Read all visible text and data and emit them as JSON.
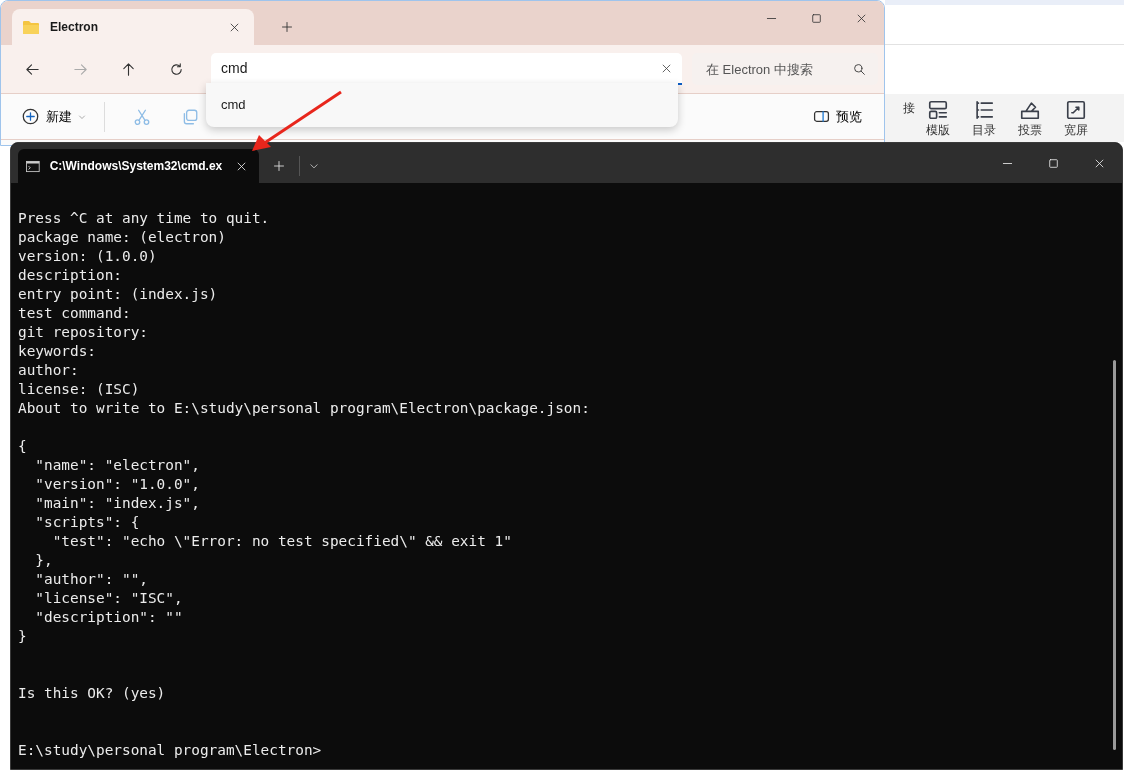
{
  "explorer": {
    "tabs": [
      {
        "title": "Electron",
        "selected": true
      }
    ],
    "address": {
      "value": "cmd",
      "focused": true
    },
    "search": {
      "placeholder": "在 Electron 中搜索"
    },
    "suggestions": [
      "cmd"
    ],
    "toolbar": {
      "new_label": "新建",
      "preview_label": "预览"
    }
  },
  "background_app": {
    "toolbar": [
      "接",
      "模版",
      "目录",
      "投票",
      "宽屏"
    ]
  },
  "terminal": {
    "tabs": [
      {
        "title": "C:\\Windows\\System32\\cmd.ex",
        "selected": true
      }
    ],
    "lines": [
      {
        "kind": "text",
        "text": "Press ^C at any time to quit."
      },
      {
        "kind": "text",
        "text": "package name: (electron)"
      },
      {
        "kind": "text",
        "text": "version: (1.0.0)"
      },
      {
        "kind": "text",
        "text": "description:"
      },
      {
        "kind": "text",
        "text": "entry point: (index.js)"
      },
      {
        "kind": "text",
        "text": "test command:"
      },
      {
        "kind": "text",
        "text": "git repository:"
      },
      {
        "kind": "text",
        "text": "keywords:"
      },
      {
        "kind": "text",
        "text": "author:"
      },
      {
        "kind": "text",
        "text": "license: (ISC)"
      },
      {
        "kind": "text",
        "text": "About to write to E:\\study\\personal program\\Electron\\package.json:"
      },
      {
        "kind": "blank"
      },
      {
        "kind": "text",
        "text": "{"
      },
      {
        "kind": "text",
        "text": "  \"name\": \"electron\","
      },
      {
        "kind": "text",
        "text": "  \"version\": \"1.0.0\","
      },
      {
        "kind": "text",
        "text": "  \"main\": \"index.js\","
      },
      {
        "kind": "text",
        "text": "  \"scripts\": {"
      },
      {
        "kind": "text",
        "text": "    \"test\": \"echo \\\"Error: no test specified\\\" && exit 1\""
      },
      {
        "kind": "text",
        "text": "  },"
      },
      {
        "kind": "text",
        "text": "  \"author\": \"\","
      },
      {
        "kind": "text",
        "text": "  \"license\": \"ISC\","
      },
      {
        "kind": "text",
        "text": "  \"description\": \"\""
      },
      {
        "kind": "text",
        "text": "}"
      },
      {
        "kind": "blank"
      },
      {
        "kind": "blank"
      },
      {
        "kind": "text",
        "text": "Is this OK? (yes)"
      },
      {
        "kind": "blank"
      },
      {
        "kind": "blank"
      },
      {
        "kind": "text",
        "text": "E:\\study\\personal program\\Electron>"
      }
    ]
  }
}
